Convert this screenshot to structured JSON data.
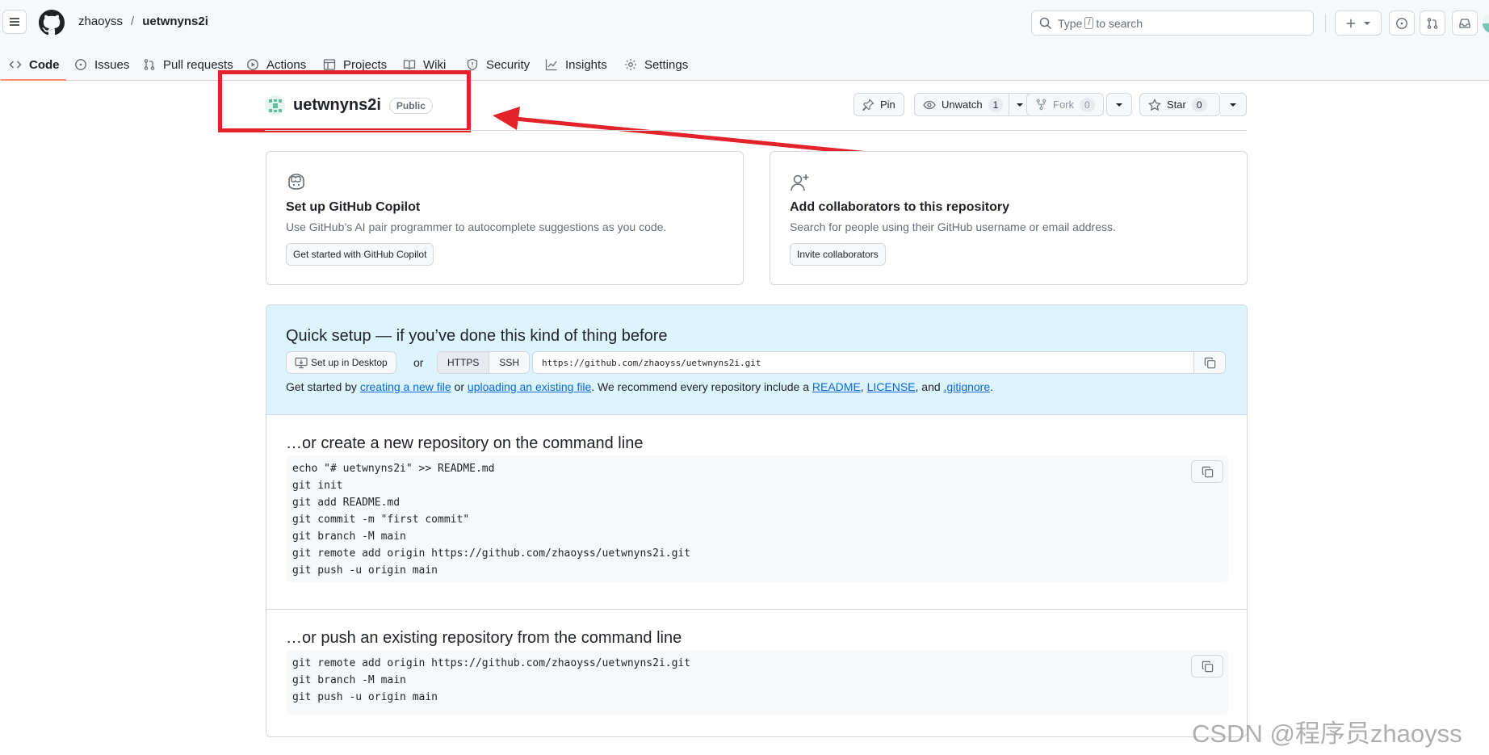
{
  "header": {
    "owner": "zhaoyss",
    "separator": "/",
    "repo": "uetwnyns2i",
    "search_prefix": "Type",
    "search_key": "/",
    "search_suffix": "to search"
  },
  "tabs": [
    {
      "label": "Code",
      "icon": "code-icon",
      "active": true
    },
    {
      "label": "Issues",
      "icon": "issue-icon"
    },
    {
      "label": "Pull requests",
      "icon": "pull-request-icon"
    },
    {
      "label": "Actions",
      "icon": "play-icon"
    },
    {
      "label": "Projects",
      "icon": "table-icon"
    },
    {
      "label": "Wiki",
      "icon": "book-icon"
    },
    {
      "label": "Security",
      "icon": "shield-icon"
    },
    {
      "label": "Insights",
      "icon": "graph-icon"
    },
    {
      "label": "Settings",
      "icon": "gear-icon"
    }
  ],
  "repo_header": {
    "name": "uetwnyns2i",
    "visibility": "Public",
    "pin_label": "Pin",
    "unwatch_label": "Unwatch",
    "watch_count": "1",
    "fork_label": "Fork",
    "fork_count": "0",
    "star_label": "Star",
    "star_count": "0"
  },
  "cards": {
    "copilot": {
      "title": "Set up GitHub Copilot",
      "desc": "Use GitHub’s AI pair programmer to autocomplete suggestions as you code.",
      "button": "Get started with GitHub Copilot"
    },
    "collab": {
      "title": "Add collaborators to this repository",
      "desc": "Search for people using their GitHub username or email address.",
      "button": "Invite collaborators"
    }
  },
  "quick_setup": {
    "title": "Quick setup — if you’ve done this kind of thing before",
    "desktop_button": "Set up in Desktop",
    "or": "or",
    "https": "HTTPS",
    "ssh": "SSH",
    "url": "https://github.com/zhaoyss/uetwnyns2i.git",
    "help": {
      "t1": "Get started by ",
      "l1": "creating a new file",
      "t2": " or ",
      "l2": "uploading an existing file",
      "t3": ". We recommend every repository include a ",
      "l3": "README",
      "t4": ", ",
      "l4": "LICENSE",
      "t5": ", and ",
      "l5": ".gitignore",
      "t6": "."
    }
  },
  "create_section": {
    "title": "…or create a new repository on the command line",
    "lines": [
      "echo \"# uetwnyns2i\" >> README.md",
      "git init",
      "git add README.md",
      "git commit -m \"first commit\"",
      "git branch -M main",
      "git remote add origin https://github.com/zhaoyss/uetwnyns2i.git",
      "git push -u origin main"
    ]
  },
  "push_section": {
    "title": "…or push an existing repository from the command line",
    "lines": [
      "git remote add origin https://github.com/zhaoyss/uetwnyns2i.git",
      "git branch -M main",
      "git push -u origin main"
    ]
  },
  "watermark": "CSDN @程序员zhaoyss",
  "colors": {
    "annotation": "#e3222a",
    "link": "#0969da",
    "active_tab": "#fd8c73",
    "quick_setup_bg": "#ddf4ff"
  }
}
